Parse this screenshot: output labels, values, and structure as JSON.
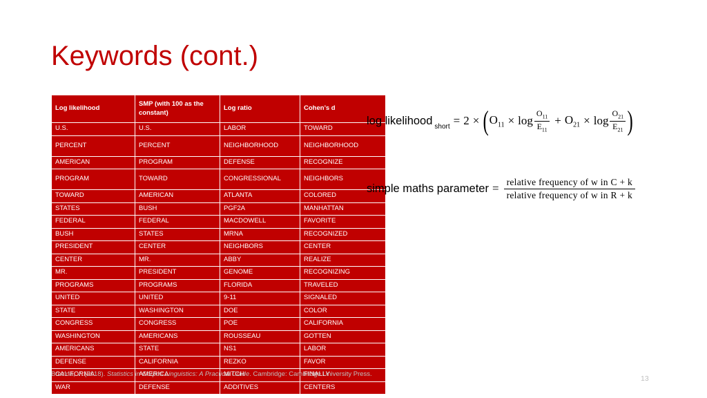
{
  "slide": {
    "title": "Keywords (cont.)",
    "page_number": "13",
    "title_color": "#c00000",
    "table_color": "#c00000"
  },
  "table": {
    "headers": [
      "Log likelihood",
      "SMP (with 100 as the constant)",
      "Log ratio",
      "Cohen’s d"
    ],
    "rows": [
      [
        "U.S.",
        "U.S.",
        "LABOR",
        "TOWARD"
      ],
      [
        "PERCENT",
        "PERCENT",
        "NEIGHBORHOOD",
        "NEIGHBORHOOD"
      ],
      [
        "AMERICAN",
        "PROGRAM",
        "DEFENSE",
        "RECOGNIZE"
      ],
      [
        "PROGRAM",
        "TOWARD",
        "CONGRESSIONAL",
        "NEIGHBORS"
      ],
      [
        "TOWARD",
        "AMERICAN",
        "ATLANTA",
        "COLORED"
      ],
      [
        "STATES",
        "BUSH",
        "PGF2A",
        "MANHATTAN"
      ],
      [
        "FEDERAL",
        "FEDERAL",
        "MACDOWELL",
        "FAVORITE"
      ],
      [
        "BUSH",
        "STATES",
        "MRNA",
        "RECOGNIZED"
      ],
      [
        "PRESIDENT",
        "CENTER",
        "NEIGHBORS",
        "CENTER"
      ],
      [
        "CENTER",
        "MR.",
        "ABBY",
        "REALIZE"
      ],
      [
        "MR.",
        "PRESIDENT",
        "GENOME",
        "RECOGNIZING"
      ],
      [
        "PROGRAMS",
        "PROGRAMS",
        "FLORIDA",
        "TRAVELED"
      ],
      [
        "UNITED",
        "UNITED",
        "9-11",
        "SIGNALED"
      ],
      [
        "STATE",
        "WASHINGTON",
        "DOE",
        "COLOR"
      ],
      [
        "CONGRESS",
        "CONGRESS",
        "POE",
        "CALIFORNIA"
      ],
      [
        "WASHINGTON",
        "AMERICANS",
        "ROUSSEAU",
        "GOTTEN"
      ],
      [
        "AMERICANS",
        "STATE",
        "NS1",
        "LABOR"
      ],
      [
        "DEFENSE",
        "CALIFORNIA",
        "REZKO",
        "FAVOR"
      ],
      [
        "CALIFORNIA",
        "AMERICA",
        "MITCH",
        "FINALLY"
      ],
      [
        "WAR",
        "DEFENSE",
        "ADDITIVES",
        "CENTERS"
      ]
    ],
    "tall_rows": [
      1,
      3
    ]
  },
  "formulas": {
    "log_likelihood": {
      "label": "log likelihood",
      "sublabel": "short",
      "equals": "=",
      "coefficient": "2",
      "times": "×",
      "open_paren": "(",
      "close_paren": ")",
      "term1_observed": "O",
      "term1_observed_sub": "11",
      "log1": "log",
      "frac1_num": "O",
      "frac1_num_sub": "11",
      "frac1_den": "E",
      "frac1_den_sub": "11",
      "plus": "+",
      "term2_observed": "O",
      "term2_observed_sub": "21",
      "log2": "log",
      "frac2_num": "O",
      "frac2_num_sub": "21",
      "frac2_den": "E",
      "frac2_den_sub": "21"
    },
    "simple_maths": {
      "label": "simple maths parameter",
      "equals": "=",
      "numerator": "relative   frequency   of w in C + k",
      "denominator": "relative   frequency   of w in R + k"
    }
  },
  "citation": {
    "author_year": "Brezina, V. (2018). ",
    "title": "Statistics in Corpus Linguistics: A Practical Guide",
    "publisher": ". Cambridge: Cambridge University Press."
  }
}
